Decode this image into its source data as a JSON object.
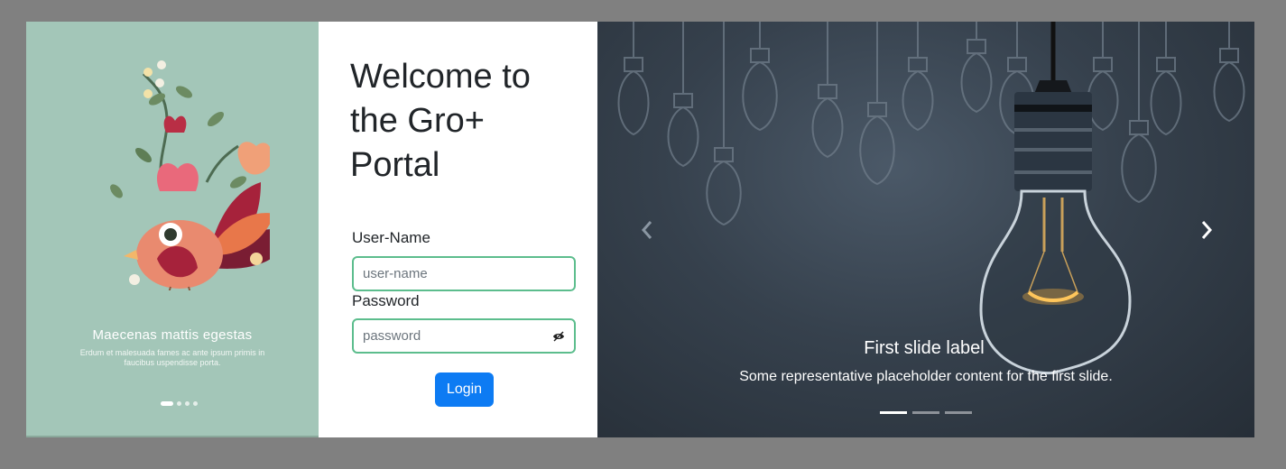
{
  "illustration": {
    "title": "Maecenas mattis egestas",
    "subtitle": "Erdum et malesuada fames ac ante ipsum primis in faucibus uspendisse porta.",
    "dots_count": 4,
    "active_dot": 0
  },
  "login": {
    "heading": "Welcome to the Gro+ Portal",
    "username_label": "User-Name",
    "username_placeholder": "user-name",
    "username_value": "",
    "password_label": "Password",
    "password_placeholder": "password",
    "password_value": "",
    "login_button": "Login"
  },
  "carousel": {
    "caption_title": "First slide label",
    "caption_text": "Some representative placeholder content for the first slide.",
    "slide_count": 3,
    "active_slide": 0,
    "prev_icon": "chevron-left-icon",
    "next_icon": "chevron-right-icon"
  },
  "colors": {
    "page_background": "#808080",
    "illustration_background": "#a3c6b8",
    "input_border": "#5cbd8d",
    "button_primary": "#0d7bf3",
    "carousel_background": "#36414d"
  }
}
